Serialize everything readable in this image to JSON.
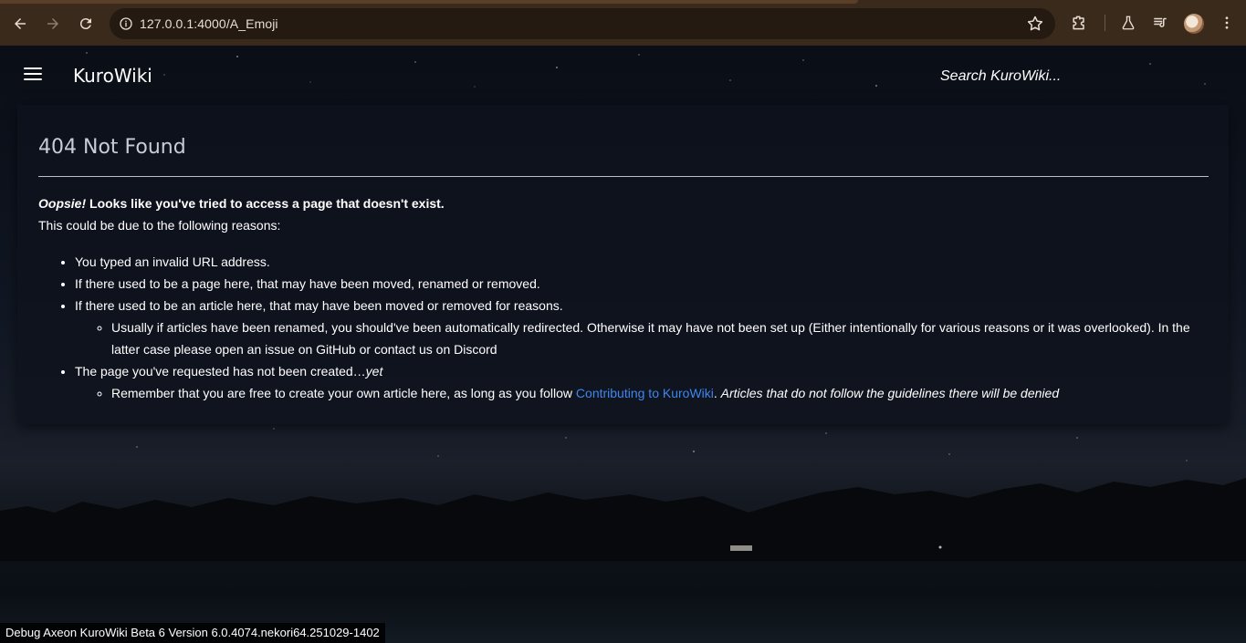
{
  "browser": {
    "url": "127.0.0.1:4000/A_Emoji",
    "colors": {
      "frame": "#3a2a1c",
      "omnibox": "#241a12"
    }
  },
  "site": {
    "brand": "KuroWiki",
    "search_placeholder": "Search KuroWiki..."
  },
  "article": {
    "title": "404 Not Found",
    "lead_em": "Oopsie!",
    "lead_rest": " Looks like you've tried to access a page that doesn't exist.",
    "intro": "This could be due to the following reasons:",
    "reasons": [
      "You typed an invalid URL address.",
      "If there used to be a page here, that may have been moved, renamed or removed.",
      "If there used to be an article here, that may have been moved or removed for reasons.",
      "Usually if articles have been renamed, you should've been automatically redirected. Otherwise it may have not been set up (Either intentionally for various reasons or it was overlooked). In the latter case please open an issue on GitHub or contact us on Discord",
      "The page you've requested has not been created…",
      "yet",
      "Remember that you are free to create your own article here, as long as you follow ",
      "Contributing to KuroWiki",
      ". ",
      "Articles that do not follow the guidelines there will be denied"
    ],
    "link_color": "#3f86ee"
  },
  "footer": {
    "debug": "Debug Axeon KuroWiki Beta 6 Version 6.0.4074.nekori64.251029-1402"
  }
}
